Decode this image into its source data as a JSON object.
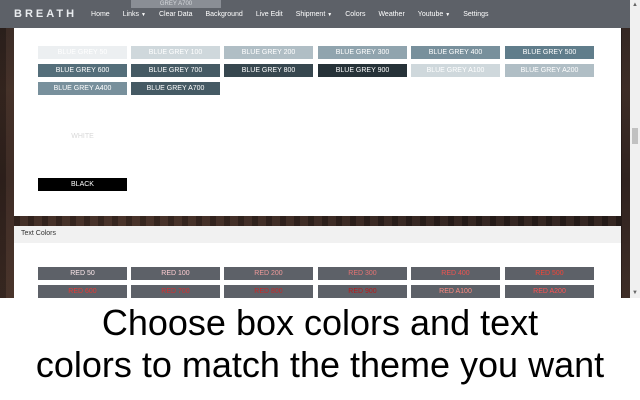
{
  "navbar": {
    "brand": "BREATH",
    "items": [
      {
        "label": "Home",
        "dropdown": false
      },
      {
        "label": "Links",
        "dropdown": true
      },
      {
        "label": "Clear Data",
        "dropdown": false
      },
      {
        "label": "Background",
        "dropdown": false
      },
      {
        "label": "Live Edit",
        "dropdown": false
      },
      {
        "label": "Shipment",
        "dropdown": true
      },
      {
        "label": "Colors",
        "dropdown": false
      },
      {
        "label": "Weather",
        "dropdown": false
      },
      {
        "label": "Youtube",
        "dropdown": true
      },
      {
        "label": "Settings",
        "dropdown": false
      }
    ],
    "ghost_tab": "GREY A700"
  },
  "box_colors": {
    "rows": [
      [
        {
          "label": "BLUE GREY 50",
          "bg": "#eceff1",
          "fg": "#ffffff"
        },
        {
          "label": "BLUE GREY 100",
          "bg": "#cfd8dc",
          "fg": "#ffffff"
        },
        {
          "label": "BLUE GREY 200",
          "bg": "#b0bec5",
          "fg": "#ffffff"
        },
        {
          "label": "BLUE GREY 300",
          "bg": "#90a4ae",
          "fg": "#ffffff"
        },
        {
          "label": "BLUE GREY 400",
          "bg": "#78909c",
          "fg": "#ffffff"
        },
        {
          "label": "BLUE GREY 500",
          "bg": "#607d8b",
          "fg": "#ffffff"
        }
      ],
      [
        {
          "label": "BLUE GREY 600",
          "bg": "#546e7a",
          "fg": "#ffffff"
        },
        {
          "label": "BLUE GREY 700",
          "bg": "#455a64",
          "fg": "#ffffff"
        },
        {
          "label": "BLUE GREY 800",
          "bg": "#37474f",
          "fg": "#ffffff"
        },
        {
          "label": "BLUE GREY 900",
          "bg": "#263238",
          "fg": "#ffffff"
        },
        {
          "label": "BLUE GREY A100",
          "bg": "#cfd8dc",
          "fg": "#ffffff"
        },
        {
          "label": "BLUE GREY A200",
          "bg": "#b0bec5",
          "fg": "#ffffff"
        }
      ],
      [
        {
          "label": "BLUE GREY A400",
          "bg": "#78909c",
          "fg": "#ffffff"
        },
        {
          "label": "BLUE GREY A700",
          "bg": "#455a64",
          "fg": "#ffffff"
        }
      ]
    ],
    "white": {
      "label": "WHITE",
      "bg": "#ffffff",
      "fg": "#d8d8d8"
    },
    "black": {
      "label": "BLACK",
      "bg": "#000000",
      "fg": "#ffffff"
    }
  },
  "text_colors": {
    "header": "Text Colors",
    "rows": [
      [
        {
          "label": "RED 50",
          "color": "#ffebee"
        },
        {
          "label": "RED 100",
          "color": "#ffcdd2"
        },
        {
          "label": "RED 200",
          "color": "#ef9a9a"
        },
        {
          "label": "RED 300",
          "color": "#e57373"
        },
        {
          "label": "RED 400",
          "color": "#ef5350"
        },
        {
          "label": "RED 500",
          "color": "#f44336"
        }
      ],
      [
        {
          "label": "RED 600",
          "color": "#e53935"
        },
        {
          "label": "RED 700",
          "color": "#d32f2f"
        },
        {
          "label": "RED 800",
          "color": "#c62828"
        },
        {
          "label": "RED 900",
          "color": "#b71c1c"
        },
        {
          "label": "RED A100",
          "color": "#ff8a80"
        },
        {
          "label": "RED A200",
          "color": "#ff5252"
        }
      ]
    ]
  },
  "caption": {
    "line1": "Choose box colors and text",
    "line2": "colors to match the theme you want"
  }
}
